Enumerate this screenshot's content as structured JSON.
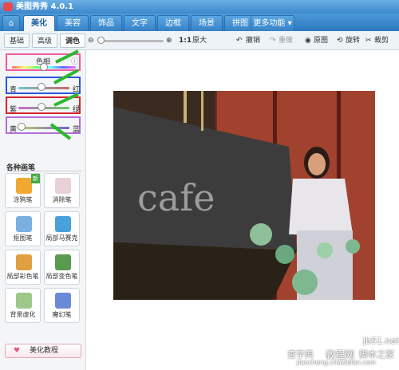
{
  "app": {
    "title": "美图秀秀 4.0.1"
  },
  "tabs": [
    "美化",
    "美容",
    "饰品",
    "文字",
    "边框",
    "场景",
    "拼图",
    "更多功能"
  ],
  "subtabs": [
    "基础",
    "高级",
    "调色"
  ],
  "toolbar": {
    "zoom_ratio": "1:1",
    "original_size": "原大",
    "undo": "撤销",
    "redo": "重做",
    "original": "原图",
    "rotate": "旋转",
    "crop": "裁剪"
  },
  "sliders": [
    {
      "label": "色相",
      "color": "#ef5aa0",
      "value": 0.5
    },
    {
      "label": "青",
      "right_label": "红",
      "color": "#2b57d9",
      "value": 0.45
    },
    {
      "label": "紫",
      "right_label": "绿",
      "color": "#d6252b",
      "value": 0.45
    },
    {
      "label": "黄",
      "right_label": "蓝",
      "color": "#b56dd8",
      "value": 0.1
    }
  ],
  "brush": {
    "section_title": "各种画笔",
    "new_badge": "新",
    "tools": [
      "涂鸦笔",
      "消除笔",
      "抠图笔",
      "局部马赛克",
      "局部彩色笔",
      "局部变色笔",
      "背景虚化",
      "魔幻笔"
    ]
  },
  "tutorial": {
    "label": "美化教程"
  },
  "photo": {
    "sign_text": "cafe"
  },
  "watermark": {
    "site": "jb51.net",
    "site_cn": "脚本之家",
    "site2": "查字典",
    "tutorial": "教程网",
    "url": "jiaocheng.chazidian.com"
  }
}
